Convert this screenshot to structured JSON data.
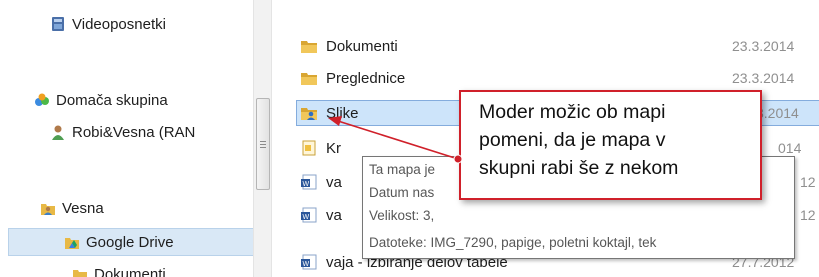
{
  "sidebar": {
    "items": [
      {
        "label": "Videoposnetki",
        "icon": "videos-library-icon"
      },
      {
        "label": "Domača skupina",
        "icon": "homegroup-icon"
      },
      {
        "label": "Robi&Vesna (RAN",
        "icon": "user-icon"
      },
      {
        "label": "Vesna",
        "icon": "user-folder-icon"
      },
      {
        "label": "Google Drive",
        "icon": "google-drive-folder-icon",
        "selected": true
      },
      {
        "label": "Dokumenti",
        "icon": "folder-icon"
      }
    ]
  },
  "files": [
    {
      "name": "Dokumenti",
      "date": "23.3.2014",
      "icon": "folder-icon"
    },
    {
      "name": "Preglednice",
      "date": "23.3.2014",
      "icon": "folder-icon"
    },
    {
      "name": "Slike",
      "date": "3.2014",
      "icon": "shared-folder-icon",
      "selected": true
    },
    {
      "name": "Kr",
      "date": "014",
      "icon": "document-icon"
    },
    {
      "name": "va",
      "date": "12",
      "icon": "word-document-icon"
    },
    {
      "name": "va",
      "date": "12",
      "icon": "word-document-icon"
    },
    {
      "name": "vaja - izbiranje delov tabele",
      "date": "27.7.2012",
      "icon": "word-document-icon"
    }
  ],
  "tooltip": {
    "lines": [
      "Ta mapa je",
      "Datum nas",
      "Velikost: 3,",
      "Datoteke: IMG_7290, papige, poletni koktajl, tek"
    ]
  },
  "callout": {
    "lines": [
      "Moder možic ob mapi",
      "pomeni, da je mapa v",
      "skupni rabi še z nekom"
    ]
  },
  "colors": {
    "selection": "#cde4fa",
    "folder": "#e8b946",
    "annotation": "#d0202a"
  }
}
